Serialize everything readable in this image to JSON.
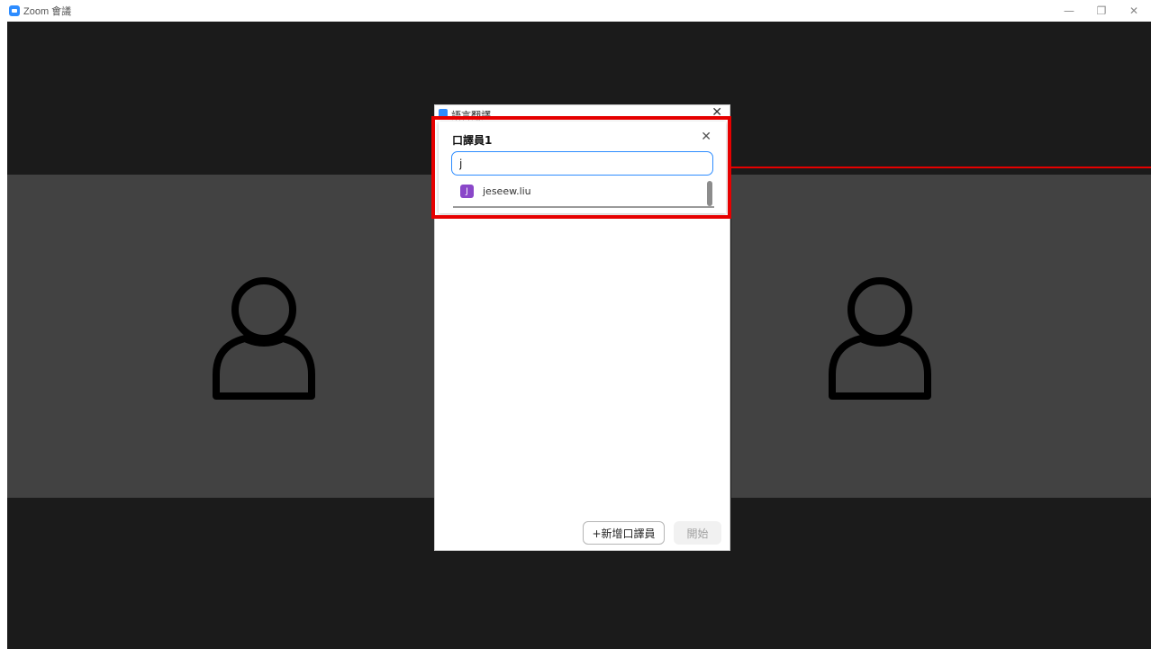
{
  "window": {
    "title": "Zoom 會議",
    "minimize_glyph": "—",
    "restore_glyph": "❐",
    "close_glyph": "✕"
  },
  "dialog": {
    "title": "語言翻譯",
    "close_glyph": "✕",
    "interpreter_card": {
      "title": "口譯員1",
      "close_glyph": "✕",
      "input_value": "j",
      "suggestions": [
        {
          "initial": "J",
          "name": "jeseew.liu",
          "avatar_color": "#8a47c9"
        }
      ]
    },
    "add_interpreter_label": "+新增口譯員",
    "start_label": "開始"
  },
  "colors": {
    "accent": "#2d8cff",
    "highlight": "#e60000",
    "stage_bg": "#1b1b1b",
    "tile_bg": "#424242"
  }
}
